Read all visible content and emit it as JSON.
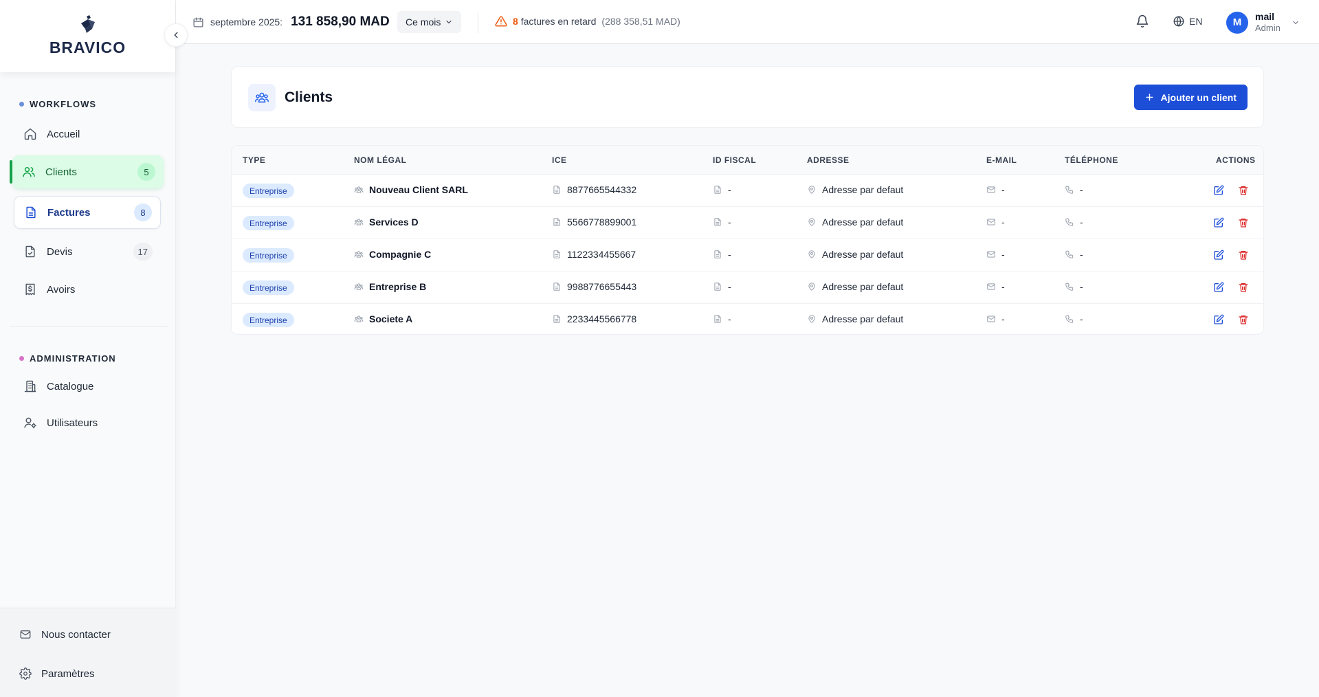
{
  "brand": {
    "name": "BRAVICO"
  },
  "sidebar": {
    "sections": [
      {
        "label": "WORKFLOWS",
        "dot_color": "#6b8fd8"
      },
      {
        "label": "ADMINISTRATION",
        "dot_color": "#d872c8"
      }
    ],
    "items": [
      {
        "label": "Accueil",
        "icon": "home-icon"
      },
      {
        "label": "Clients",
        "icon": "users-icon",
        "badge": "5",
        "active": true
      },
      {
        "label": "Factures",
        "icon": "file-text-icon",
        "badge": "8"
      },
      {
        "label": "Devis",
        "icon": "file-check-icon",
        "badge": "17"
      },
      {
        "label": "Avoirs",
        "icon": "receipt-icon"
      },
      {
        "label": "Catalogue",
        "icon": "building-icon"
      },
      {
        "label": "Utilisateurs",
        "icon": "user-gear-icon"
      }
    ],
    "footer": [
      {
        "label": "Nous contacter",
        "icon": "mail-icon"
      },
      {
        "label": "Paramètres",
        "icon": "gear-icon"
      }
    ]
  },
  "topbar": {
    "date_label": "septembre 2025:",
    "amount": "131 858,90 MAD",
    "period": "Ce mois",
    "alert_count": "8",
    "alert_text": "factures en retard",
    "alert_amount": "(288 358,51 MAD)",
    "lang": "EN",
    "user": {
      "initial": "M",
      "name": "mail",
      "role": "Admin"
    }
  },
  "page": {
    "title": "Clients",
    "add_button": "Ajouter un client"
  },
  "table": {
    "columns": [
      "TYPE",
      "NOM LÉGAL",
      "ICE",
      "ID FISCAL",
      "ADRESSE",
      "E-MAIL",
      "TÉLÉPHONE",
      "ACTIONS"
    ],
    "rows": [
      {
        "type": "Entreprise",
        "name": "Nouveau Client SARL",
        "ice": "8877665544332",
        "id_fiscal": "-",
        "adresse": "Adresse par defaut",
        "email": "-",
        "telephone": "-"
      },
      {
        "type": "Entreprise",
        "name": "Services D",
        "ice": "5566778899001",
        "id_fiscal": "-",
        "adresse": "Adresse par defaut",
        "email": "-",
        "telephone": "-"
      },
      {
        "type": "Entreprise",
        "name": "Compagnie C",
        "ice": "1122334455667",
        "id_fiscal": "-",
        "adresse": "Adresse par defaut",
        "email": "-",
        "telephone": "-"
      },
      {
        "type": "Entreprise",
        "name": "Entreprise B",
        "ice": "9988776655443",
        "id_fiscal": "-",
        "adresse": "Adresse par defaut",
        "email": "-",
        "telephone": "-"
      },
      {
        "type": "Entreprise",
        "name": "Societe A",
        "ice": "2233445566778",
        "id_fiscal": "-",
        "adresse": "Adresse par defaut",
        "email": "-",
        "telephone": "-"
      }
    ]
  },
  "colors": {
    "accent": "#1d4ed8",
    "active_green": "#16a34a",
    "warning": "#ea580c",
    "danger": "#dc2626"
  }
}
